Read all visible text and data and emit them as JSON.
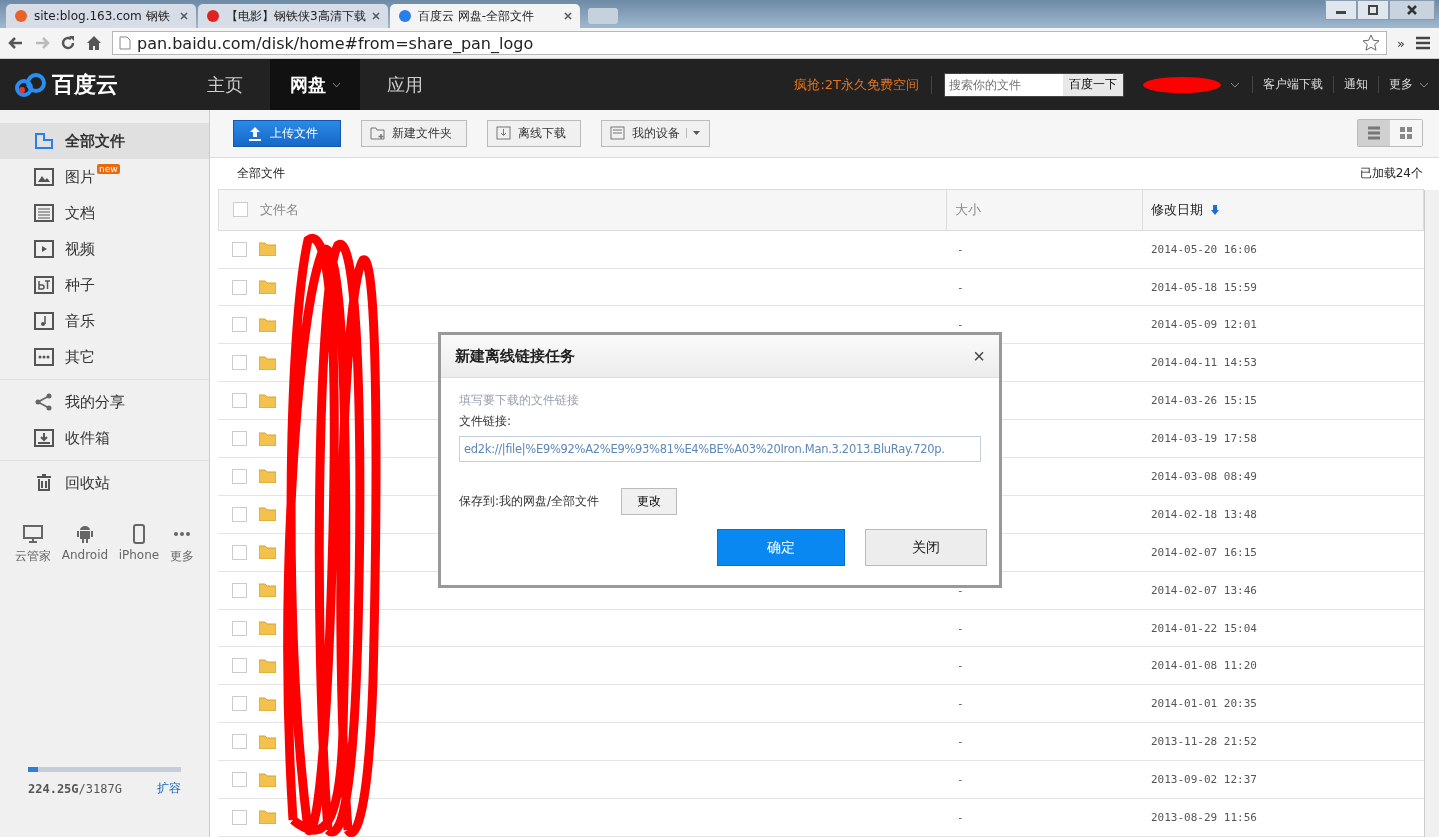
{
  "browser": {
    "tabs": [
      {
        "title": "site:blog.163.com 钢铁",
        "selected": false
      },
      {
        "title": "【电影】钢铁侠3高清下载",
        "selected": false
      },
      {
        "title": "百度云 网盘-全部文件",
        "selected": true
      }
    ],
    "address": "pan.baidu.com/disk/home#from=share_pan_logo",
    "overflow": "»"
  },
  "nav": {
    "logo": "百度云",
    "items": [
      {
        "label": "主页",
        "selected": false
      },
      {
        "label": "网盘",
        "selected": true
      },
      {
        "label": "应用",
        "selected": false
      }
    ],
    "promo": "疯抢:2T永久免费空间",
    "search": {
      "placeholder": "搜索你的文件",
      "button": "百度一下"
    },
    "links": [
      "客户端下载",
      "通知",
      "更多"
    ]
  },
  "sidebar": {
    "items": [
      {
        "label": "全部文件",
        "selected": true
      },
      {
        "label": "图片",
        "selected": false,
        "badge": "new"
      },
      {
        "label": "文档",
        "selected": false
      },
      {
        "label": "视频",
        "selected": false
      },
      {
        "label": "种子",
        "selected": false
      },
      {
        "label": "音乐",
        "selected": false
      },
      {
        "label": "其它",
        "selected": false
      }
    ],
    "items2": [
      {
        "label": "我的分享",
        "selected": false
      },
      {
        "label": "收件箱",
        "selected": false
      }
    ],
    "items3": [
      {
        "label": "回收站",
        "selected": false
      }
    ],
    "apps": [
      "云管家",
      "Android",
      "iPhone",
      "更多"
    ],
    "storage": {
      "level": 0.065,
      "used": "224.25G",
      "total": "/3187G",
      "link": "扩容"
    }
  },
  "toolbar": {
    "buttons": [
      "上传文件",
      "新建文件夹",
      "离线下载",
      "我的设备"
    ],
    "view": [
      {
        "selected": true
      },
      {
        "selected": false
      }
    ]
  },
  "breadcrumb": "全部文件",
  "loaded": "已加载24个",
  "table": {
    "columns": [
      "文件名",
      "大小",
      "修改日期"
    ],
    "all_checked": false,
    "rows": [
      {
        "checked": false,
        "size": "-",
        "date": "2014-05-20 16:06"
      },
      {
        "checked": false,
        "size": "-",
        "date": "2014-05-18 15:59"
      },
      {
        "checked": false,
        "size": "-",
        "date": "2014-05-09 12:01"
      },
      {
        "checked": false,
        "date": "2014-04-11 14:53"
      },
      {
        "checked": false,
        "date": "2014-03-26 15:15"
      },
      {
        "checked": false,
        "date": "2014-03-19 17:58"
      },
      {
        "checked": false,
        "date": "2014-03-08 08:49"
      },
      {
        "checked": false,
        "date": "2014-02-18 13:48"
      },
      {
        "checked": false,
        "date": "2014-02-07 16:15"
      },
      {
        "checked": false,
        "size": "-",
        "date": "2014-02-07 13:46"
      },
      {
        "checked": false,
        "size": "-",
        "date": "2014-01-22 15:04"
      },
      {
        "checked": false,
        "size": "-",
        "date": "2014-01-08 11:20"
      },
      {
        "checked": false,
        "size": "-",
        "date": "2014-01-01 20:35"
      },
      {
        "checked": false,
        "size": "-",
        "date": "2013-11-28 21:52"
      },
      {
        "checked": false,
        "size": "-",
        "date": "2013-09-02 12:37"
      },
      {
        "checked": false,
        "size": "-",
        "date": "2013-08-29 11:56"
      }
    ]
  },
  "dialog": {
    "title": "新建离线链接任务",
    "close": "×",
    "hint": "填写要下载的文件链接",
    "field_label": "文件链接:",
    "value": "ed2k://|file|%E9%92%A2%E9%93%81%E4%BE%A03%20Iron.Man.3.2013.BluRay.720p.",
    "save_label": "保存到:我的网盘/全部文件",
    "change": "更改",
    "ok": "确定",
    "cancel": "关闭"
  }
}
